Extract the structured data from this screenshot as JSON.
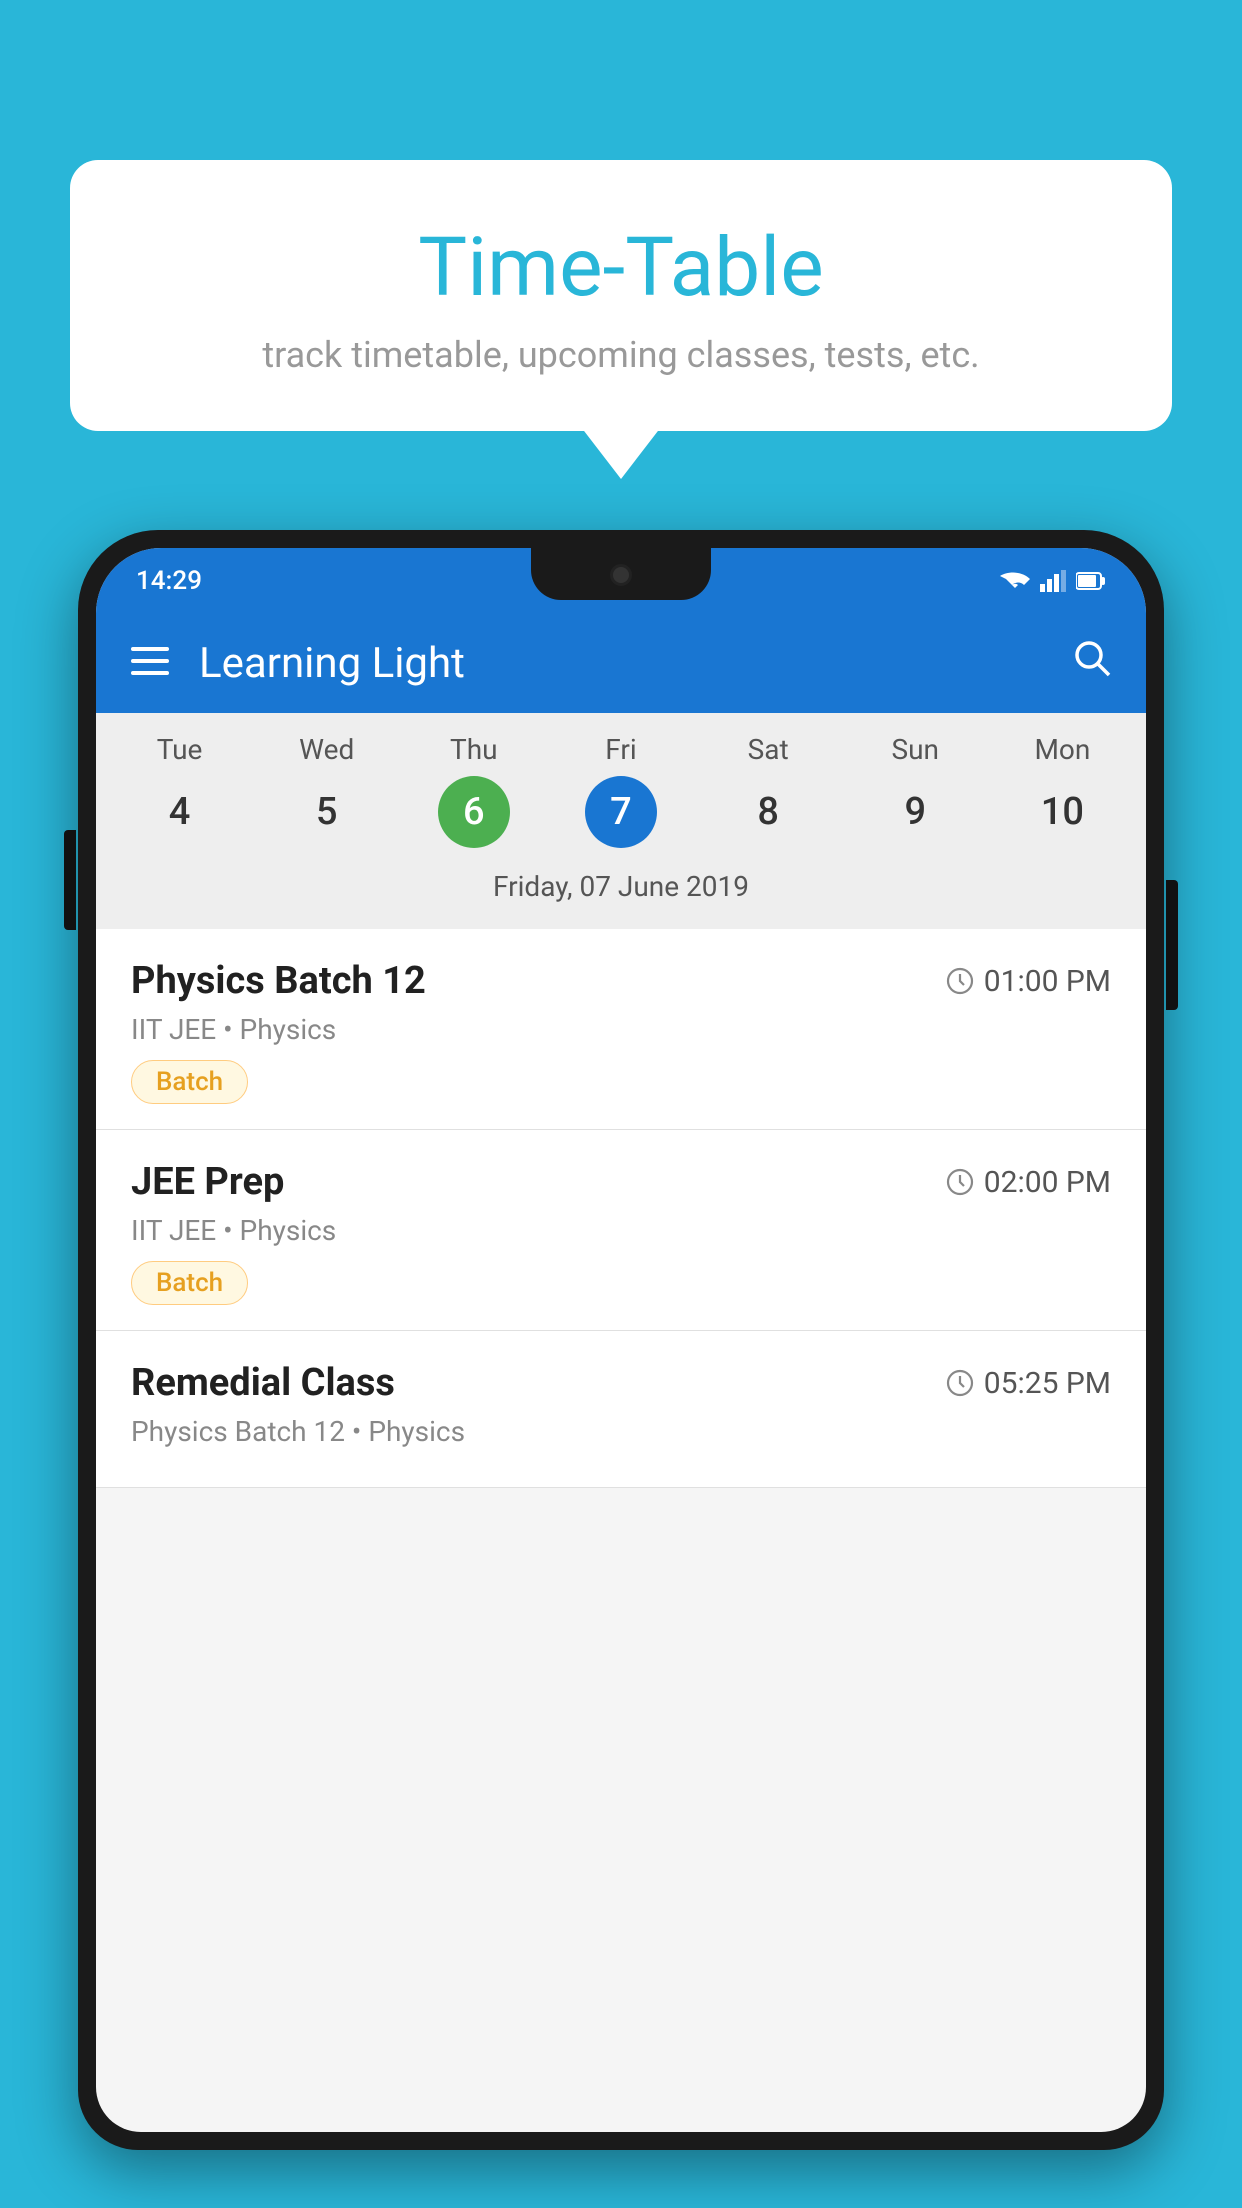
{
  "background_color": "#29b6d8",
  "bubble": {
    "title": "Time-Table",
    "subtitle": "track timetable, upcoming classes, tests, etc."
  },
  "phone": {
    "status_bar": {
      "time": "14:29",
      "icons": [
        "wifi",
        "signal",
        "battery"
      ]
    },
    "app_bar": {
      "title": "Learning Light",
      "menu_icon": "menu",
      "search_icon": "search"
    },
    "calendar": {
      "days": [
        {
          "name": "Tue",
          "number": "4",
          "state": "normal"
        },
        {
          "name": "Wed",
          "number": "5",
          "state": "normal"
        },
        {
          "name": "Thu",
          "number": "6",
          "state": "today"
        },
        {
          "name": "Fri",
          "number": "7",
          "state": "selected"
        },
        {
          "name": "Sat",
          "number": "8",
          "state": "normal"
        },
        {
          "name": "Sun",
          "number": "9",
          "state": "normal"
        },
        {
          "name": "Mon",
          "number": "10",
          "state": "normal"
        }
      ],
      "selected_date_label": "Friday, 07 June 2019"
    },
    "schedule": [
      {
        "title": "Physics Batch 12",
        "time": "01:00 PM",
        "subtitle": "IIT JEE • Physics",
        "tag": "Batch"
      },
      {
        "title": "JEE Prep",
        "time": "02:00 PM",
        "subtitle": "IIT JEE • Physics",
        "tag": "Batch"
      },
      {
        "title": "Remedial Class",
        "time": "05:25 PM",
        "subtitle": "Physics Batch 12 • Physics",
        "tag": null
      }
    ]
  }
}
